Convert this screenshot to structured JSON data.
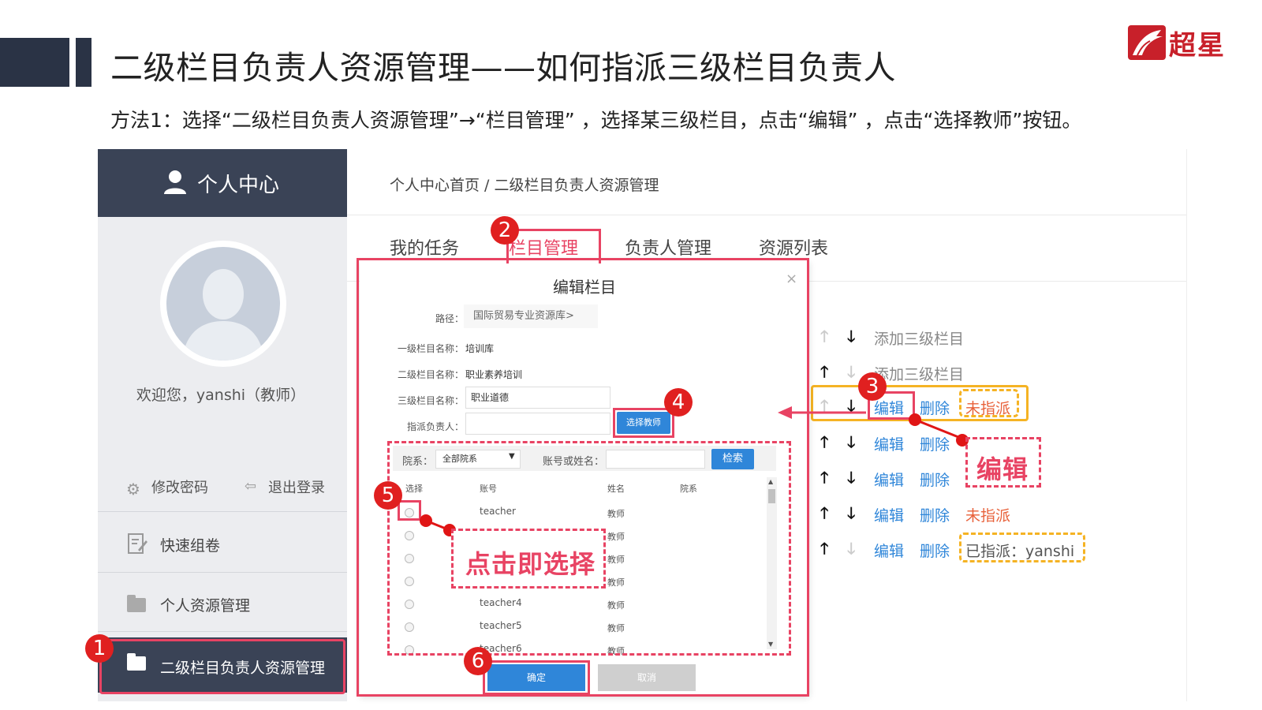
{
  "slide": {
    "title": "二级栏目负责人资源管理——如何指派三级栏目负责人",
    "instruction": "方法1：选择“二级栏目负责人资源管理”→“栏目管理” ，选择某三级栏目，点击“编辑” ，点击“选择教师”按钮。",
    "logo_text": "超星"
  },
  "sidebar": {
    "header_label": "个人中心",
    "welcome": "欢迎您，yanshi（教师）",
    "change_password": "修改密码",
    "logout": "退出登录",
    "menu": [
      {
        "label": "快速组卷"
      },
      {
        "label": "个人资源管理"
      },
      {
        "label": "二级栏目负责人资源管理"
      }
    ]
  },
  "main": {
    "breadcrumb": "个人中心首页 / 二级栏目负责人资源管理",
    "tabs": [
      {
        "label": "我的任务"
      },
      {
        "label": "栏目管理"
      },
      {
        "label": "负责人管理"
      },
      {
        "label": "资源列表"
      }
    ],
    "tree_rows": [
      {
        "edit": "",
        "delete": "",
        "status": "",
        "add": "添加三级栏目"
      },
      {
        "edit": "",
        "delete": "",
        "status": "",
        "add": "添加三级栏目"
      },
      {
        "edit": "编辑",
        "delete": "删除",
        "status": "未指派"
      },
      {
        "edit": "编辑",
        "delete": "删除",
        "status": ""
      },
      {
        "edit": "编辑",
        "delete": "删除",
        "status": ""
      },
      {
        "edit": "编辑",
        "delete": "删除",
        "status": "未指派"
      },
      {
        "edit": "编辑",
        "delete": "删除",
        "status": "已指派：yanshi"
      }
    ]
  },
  "modal": {
    "title": "编辑栏目",
    "close": "×",
    "path_label": "路径：",
    "path_value": "国际贸易专业资源库>",
    "level1_label": "一级栏目名称：",
    "level1_value": "培训库",
    "level2_label": "二级栏目名称：",
    "level2_value": "职业素养培训",
    "level3_label": "三级栏目名称：",
    "level3_value": "职业道德",
    "assign_label": "指派负责人：",
    "assign_value": "",
    "select_teacher": "选择教师",
    "dept_label": "院系：",
    "dept_value": "全部院系",
    "account_label": "账号或姓名：",
    "search": "检索",
    "columns": [
      "选择",
      "账号",
      "姓名",
      "院系"
    ],
    "rows": [
      {
        "account": "teacher",
        "name": "教师"
      },
      {
        "account": "",
        "name": "教师"
      },
      {
        "account": "",
        "name": "教师"
      },
      {
        "account": "",
        "name": "教师"
      },
      {
        "account": "teacher4",
        "name": "教师"
      },
      {
        "account": "teacher5",
        "name": "教师"
      },
      {
        "account": "teacher6",
        "name": "教师"
      }
    ],
    "ok": "确定",
    "cancel": "取消"
  },
  "annotations": {
    "steps": [
      "1",
      "2",
      "3",
      "4",
      "5",
      "6"
    ],
    "callout_edit": "编辑",
    "callout_select": "点击即选择"
  },
  "colors": {
    "sidebar_dark": "#3a4356",
    "accent_pink": "#e84363",
    "badge_red": "#e02020",
    "link_blue": "#2f86d9",
    "status_orange": "#e8613a",
    "highlight_yellow": "#f5b324"
  }
}
